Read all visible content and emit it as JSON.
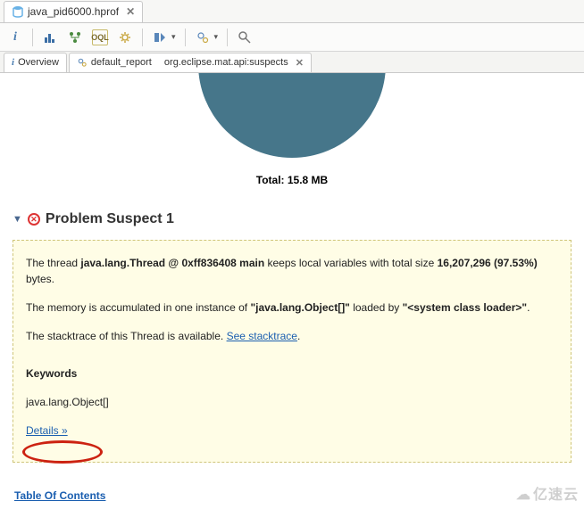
{
  "file_tab": {
    "label": "java_pid6000.hprof"
  },
  "toolbar": {
    "info_icon": "i",
    "search_icon": "search"
  },
  "inner_tabs": {
    "overview": {
      "label": "Overview"
    },
    "default_report": {
      "label_left": "default_report",
      "label_right": "org.eclipse.mat.api:suspects"
    }
  },
  "pie": {
    "total_label": "Total: 15.8 MB"
  },
  "section": {
    "title": "Problem Suspect 1"
  },
  "suspect": {
    "p1_pre": "The thread ",
    "p1_bold1": "java.lang.Thread @ 0xff836408 main",
    "p1_mid": " keeps local variables with total size ",
    "p1_bold2": "16,207,296 (97.53%)",
    "p1_post": " bytes.",
    "p2_pre": "The memory is accumulated in one instance of ",
    "p2_bold1": "\"java.lang.Object[]\"",
    "p2_mid": " loaded by ",
    "p2_bold2": "\"<system class loader>\"",
    "p2_post": ".",
    "p3_pre": "The stacktrace of this Thread is available. ",
    "p3_link": "See stacktrace",
    "p3_post": ".",
    "kw_head": "Keywords",
    "kw_item": "java.lang.Object[]",
    "details_link": "Details »"
  },
  "toc": {
    "label": "Table Of Contents"
  },
  "watermark": "亿速云",
  "chart_data": {
    "type": "pie",
    "title": "",
    "slices": [
      {
        "name": "Problem Suspect 1",
        "value_mb": 15.8,
        "percent": 97.53
      }
    ],
    "total_label": "Total: 15.8 MB",
    "total_value_mb": 15.8
  }
}
